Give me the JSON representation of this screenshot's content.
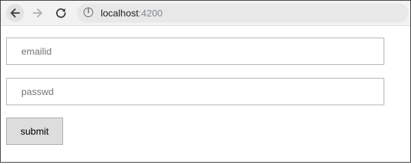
{
  "browser": {
    "url_host": "localhost",
    "url_port": ":4200",
    "icons": {
      "back": "back-arrow-icon",
      "forward": "forward-arrow-icon",
      "reload": "reload-icon",
      "info": "info-icon"
    }
  },
  "form": {
    "email_placeholder": "emailid",
    "email_value": "",
    "password_placeholder": "passwd",
    "password_value": "",
    "submit_label": "submit"
  },
  "colors": {
    "toolbar_bg": "#f2f2f2",
    "address_bar_bg": "#e8e8e8",
    "button_bg": "#dddddd",
    "field_border": "#b0b0b0"
  }
}
